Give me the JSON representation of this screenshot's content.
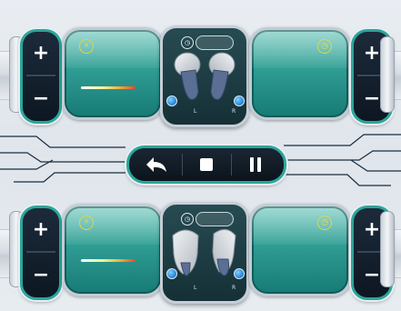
{
  "colors": {
    "accent_teal": "#2aa69a",
    "screen_teal": "#2f9d93",
    "button_dark": "#0d1722",
    "icon_yellow": "#e8d23a",
    "dot_blue": "#1f7fd6"
  },
  "icons": {
    "plus": "plus-icon",
    "minus": "minus-icon",
    "bolt": "bolt-icon",
    "clock": "clock-icon",
    "timer": "timer-icon",
    "back": "back-arrow-icon",
    "stop": "stop-icon",
    "pause": "pause-icon",
    "earbud": "earbud-icon"
  },
  "labels": {
    "plus": "+",
    "minus": "−"
  },
  "top_unit": {
    "left_marker": "L",
    "right_marker": "R"
  },
  "bottom_unit": {
    "left_marker": "L",
    "right_marker": "R"
  }
}
